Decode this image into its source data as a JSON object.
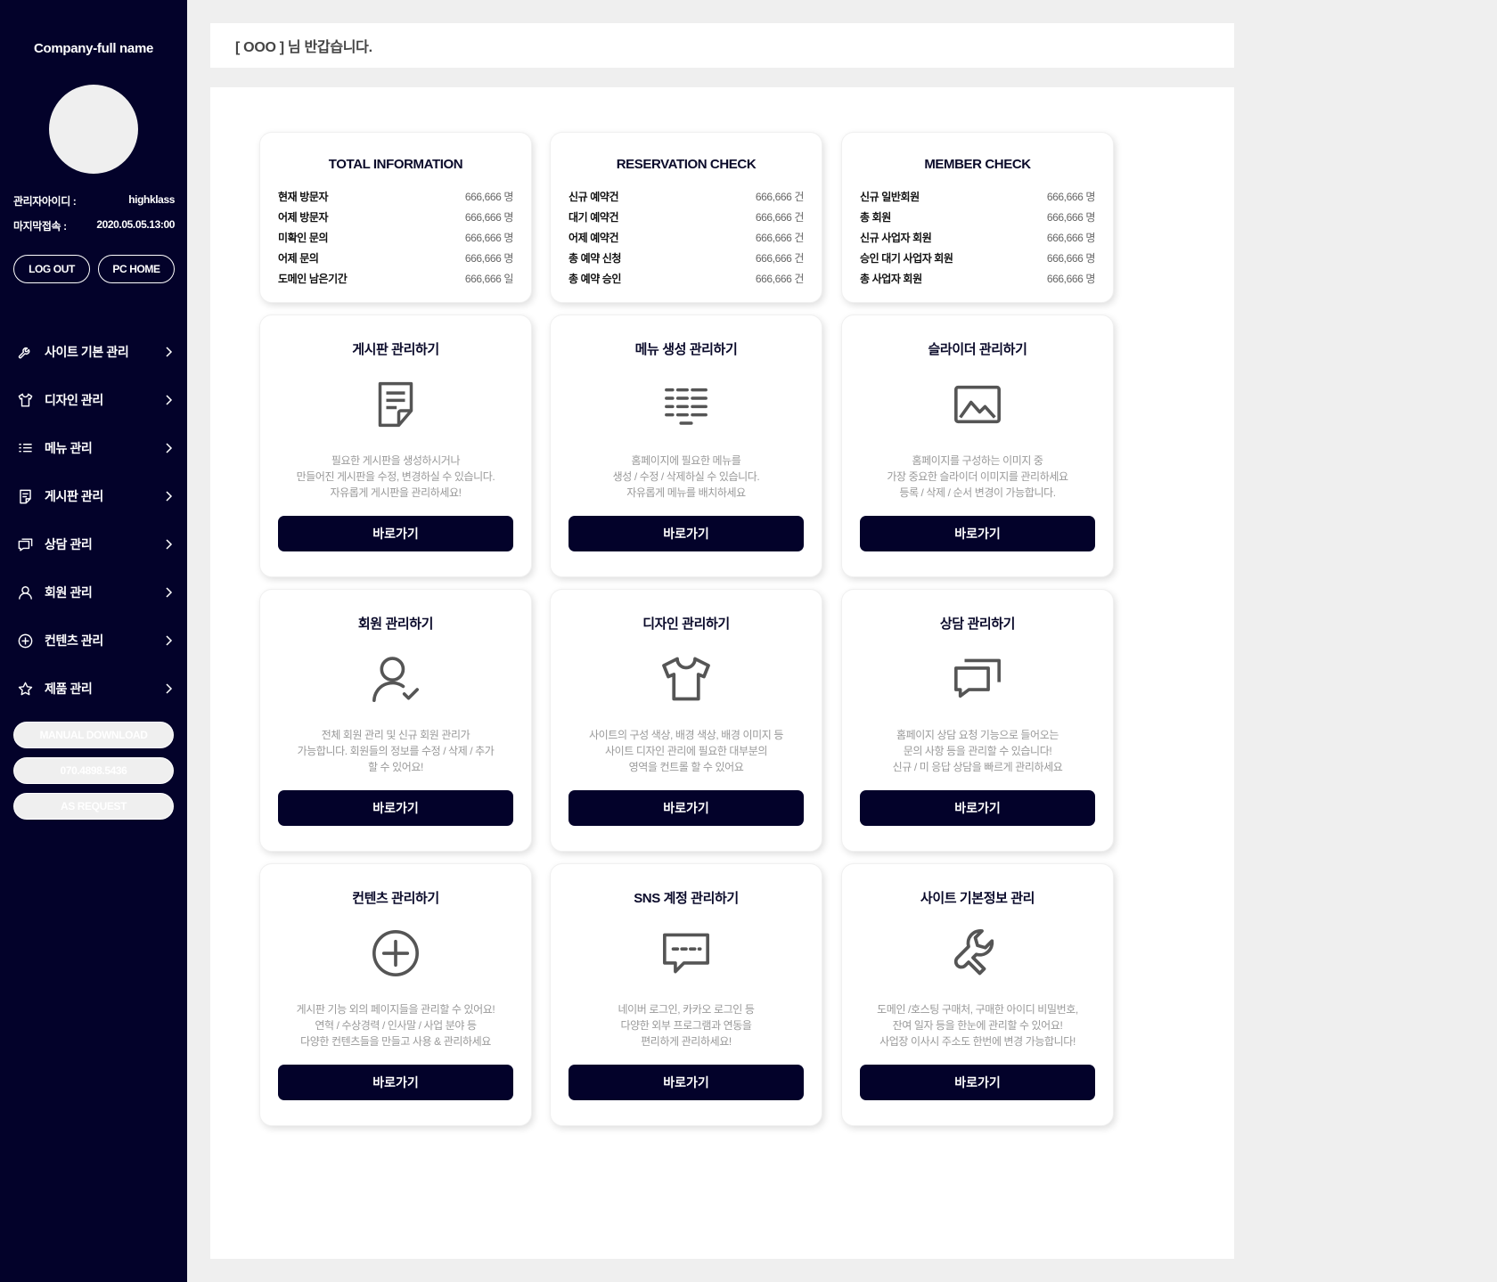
{
  "sidebar": {
    "company": "Company-full name",
    "admin_id_label": "관리자아이디 :",
    "admin_id_value": "highklass",
    "last_login_label": "마지막접속 :",
    "last_login_value": "2020.05.05.13:00",
    "logout_label": "LOG OUT",
    "pchome_label": "PC HOME",
    "nav": [
      {
        "label": "사이트 기본 관리",
        "icon": "wrench-icon"
      },
      {
        "label": "디자인 관리",
        "icon": "shirt-icon"
      },
      {
        "label": "메뉴 관리",
        "icon": "menu-list-icon"
      },
      {
        "label": "게시판 관리",
        "icon": "board-icon"
      },
      {
        "label": "상담 관리",
        "icon": "chat-icon"
      },
      {
        "label": "회원 관리",
        "icon": "user-icon"
      },
      {
        "label": "컨텐츠 관리",
        "icon": "plus-circle-icon"
      },
      {
        "label": "제품 관리",
        "icon": "star-icon"
      }
    ],
    "manual_label": "MANUAL DOWNLOAD",
    "phone_label": "070.4898.5436",
    "as_label": "AS REQUEST"
  },
  "header": {
    "greeting": "[ OOO ] 님 반갑습니다."
  },
  "stats": [
    {
      "title": "TOTAL INFORMATION",
      "rows": [
        {
          "k": "현재 방문자",
          "v": "666,666 명"
        },
        {
          "k": "어제 방문자",
          "v": "666,666 명"
        },
        {
          "k": "미확인 문의",
          "v": "666,666 명"
        },
        {
          "k": "어제 문의",
          "v": "666,666 명"
        },
        {
          "k": "도메인 남은기간",
          "v": "666,666 일"
        }
      ]
    },
    {
      "title": "RESERVATION CHECK",
      "rows": [
        {
          "k": "신규 예약건",
          "v": "666,666 건"
        },
        {
          "k": "대기 예약건",
          "v": "666,666 건"
        },
        {
          "k": "어제 예약건",
          "v": "666,666 건"
        },
        {
          "k": "총 예약 신청",
          "v": "666,666 건"
        },
        {
          "k": "총 예약 승인",
          "v": "666,666 건"
        }
      ]
    },
    {
      "title": "MEMBER CHECK",
      "rows": [
        {
          "k": "신규 일반회원",
          "v": "666,666 명"
        },
        {
          "k": "총 회원",
          "v": "666,666 명"
        },
        {
          "k": "신규 사업자 회원",
          "v": "666,666 명"
        },
        {
          "k": "승인 대기 사업자 회원",
          "v": "666,666 명"
        },
        {
          "k": "총 사업자 회원",
          "v": "666,666 명"
        }
      ]
    }
  ],
  "go_label": "바로가기",
  "features": [
    {
      "title": "게시판 관리하기",
      "icon": "board-icon",
      "desc": [
        "필요한 게시판을 생성하시거나",
        "만들어진 게시판을 수정, 변경하실 수 있습니다.",
        "자유롭게 게시판을 관리하세요!"
      ]
    },
    {
      "title": "메뉴 생성 관리하기",
      "icon": "menu-list-icon",
      "desc": [
        "홈페이지에 필요한 메뉴를",
        "생성 / 수정 / 삭제하실 수 있습니다.",
        "자유롭게 메뉴를 배치하세요"
      ]
    },
    {
      "title": "슬라이더 관리하기",
      "icon": "image-icon",
      "desc": [
        "홈페이지를 구성하는 이미지 중",
        "가장 중요한 슬라이더 이미지를 관리하세요",
        "등록 / 삭제 / 순서 변경이 가능합니다."
      ]
    },
    {
      "title": "회원 관리하기",
      "icon": "user-check-icon",
      "desc": [
        "전체 회원 관리 및 신규 회원 관리가",
        "가능합니다. 회원들의 정보를 수정 / 삭제 / 추가",
        "할 수 있어요!"
      ]
    },
    {
      "title": "디자인 관리하기",
      "icon": "shirt-icon",
      "desc": [
        "사이트의 구성 색상, 배경 색상, 배경 이미지 등",
        "사이트 디자인 관리에 필요한 대부분의",
        "영역을 컨트롤 할 수 있어요"
      ]
    },
    {
      "title": "상담 관리하기",
      "icon": "chat-icon",
      "desc": [
        "홈페이지 상담 요청 기능으로 들어오는",
        "문의 사항 등을 관리할 수 있습니다!",
        "신규 / 미 응답 상담을 빠르게 관리하세요"
      ]
    },
    {
      "title": "컨텐츠 관리하기",
      "icon": "plus-circle-icon",
      "desc": [
        "게시판 기능 외의 페이지들을 관리할 수 있어요!",
        "연혁 / 수상경력 / 인사말 / 사업 분야 등",
        "다양한 컨텐츠들을 만들고 사용 & 관리하세요"
      ]
    },
    {
      "title": "SNS 계정 관리하기",
      "icon": "sns-chat-icon",
      "desc": [
        "네이버 로그인, 카카오 로그인 등",
        "다양한 외부 프로그램과 연동을",
        "편리하게 관리하세요!"
      ]
    },
    {
      "title": "사이트 기본정보 관리",
      "icon": "wrench-icon",
      "desc": [
        "도메인 /호스팅 구매처, 구매한 아이디 비밀번호,",
        "잔여 일자 등을 한눈에 관리할 수 있어요!",
        "사업장 이사시 주소도 한번에 변경 가능합니다!"
      ]
    }
  ],
  "colors": {
    "sidebar_bg": "#03022a",
    "button_bg": "#03022a",
    "page_bg": "#efefef"
  }
}
